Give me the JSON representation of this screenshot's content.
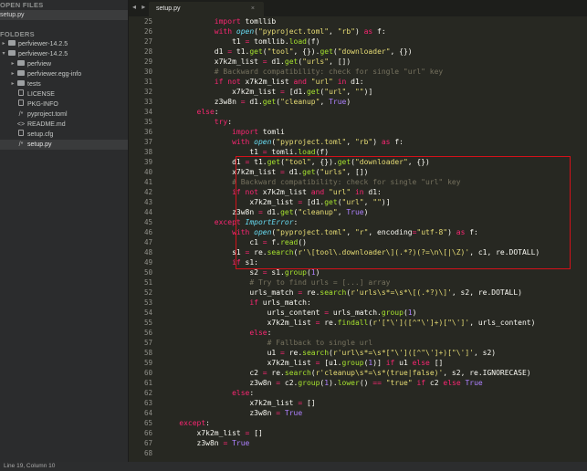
{
  "sidebar": {
    "open_files_title": "OPEN FILES",
    "open_files": [
      "setup.py"
    ],
    "folders_title": "FOLDERS",
    "tree": [
      {
        "label": "perfviewer-14.2.5",
        "depth": 0,
        "kind": "folder",
        "arrow": "▸"
      },
      {
        "label": "perfviewer-14.2.5",
        "depth": 0,
        "kind": "folder-open",
        "arrow": "▾"
      },
      {
        "label": "perfview",
        "depth": 1,
        "kind": "folder",
        "arrow": "▸"
      },
      {
        "label": "perfviewer.egg-info",
        "depth": 1,
        "kind": "folder",
        "arrow": "▸"
      },
      {
        "label": "tests",
        "depth": 1,
        "kind": "folder",
        "arrow": "▸"
      },
      {
        "label": "LICENSE",
        "depth": 1,
        "kind": "file",
        "arrow": ""
      },
      {
        "label": "PKG-INFO",
        "depth": 1,
        "kind": "file",
        "arrow": ""
      },
      {
        "label": "pyproject.toml",
        "depth": 1,
        "kind": "code",
        "arrow": ""
      },
      {
        "label": "README.md",
        "depth": 1,
        "kind": "markup",
        "arrow": ""
      },
      {
        "label": "setup.cfg",
        "depth": 1,
        "kind": "file",
        "arrow": ""
      },
      {
        "label": "setup.py",
        "depth": 1,
        "kind": "code",
        "arrow": "",
        "selected": true
      }
    ]
  },
  "tabs": {
    "nav": "◂ ▸",
    "active": "setup.py",
    "close": "×"
  },
  "editor": {
    "first_line": 25,
    "lines": [
      [
        [
          "",
          "            "
        ],
        [
          "kw",
          "import"
        ],
        [
          "",
          " tomllib"
        ]
      ],
      [
        [
          "",
          "            "
        ],
        [
          "kw",
          "with"
        ],
        [
          "",
          " "
        ],
        [
          "fn",
          "open"
        ],
        [
          "",
          "("
        ],
        [
          "st",
          "\"pyproject.toml\""
        ],
        [
          "",
          ", "
        ],
        [
          "st",
          "\"rb\""
        ],
        [
          "",
          ") "
        ],
        [
          "kw",
          "as"
        ],
        [
          "",
          " f:"
        ]
      ],
      [
        [
          "",
          "                t1 "
        ],
        [
          "kw",
          "="
        ],
        [
          "",
          " tomllib."
        ],
        [
          "bi",
          "load"
        ],
        [
          "",
          "(f)"
        ]
      ],
      [
        [
          "",
          "            d1 "
        ],
        [
          "kw",
          "="
        ],
        [
          "",
          " t1."
        ],
        [
          "bi",
          "get"
        ],
        [
          "",
          "("
        ],
        [
          "st",
          "\"tool\""
        ],
        [
          "",
          ", {})."
        ],
        [
          "bi",
          "get"
        ],
        [
          "",
          "("
        ],
        [
          "st",
          "\"downloader\""
        ],
        [
          "",
          ", {})"
        ]
      ],
      [
        [
          "",
          "            x7k2m_list "
        ],
        [
          "kw",
          "="
        ],
        [
          "",
          " d1."
        ],
        [
          "bi",
          "get"
        ],
        [
          "",
          "("
        ],
        [
          "st",
          "\"urls\""
        ],
        [
          "",
          ", [])"
        ]
      ],
      [
        [
          "cm",
          "            # Backward compatibility: check for single \"url\" key"
        ]
      ],
      [
        [
          "",
          "            "
        ],
        [
          "kw",
          "if not"
        ],
        [
          "",
          " x7k2m_list "
        ],
        [
          "kw",
          "and"
        ],
        [
          "",
          " "
        ],
        [
          "st",
          "\"url\""
        ],
        [
          "",
          " "
        ],
        [
          "kw",
          "in"
        ],
        [
          "",
          " d1:"
        ]
      ],
      [
        [
          "",
          "                x7k2m_list "
        ],
        [
          "kw",
          "="
        ],
        [
          "",
          " [d1."
        ],
        [
          "bi",
          "get"
        ],
        [
          "",
          "("
        ],
        [
          "st",
          "\"url\""
        ],
        [
          "",
          ", "
        ],
        [
          "st",
          "\"\""
        ],
        [
          "",
          ")]"
        ]
      ],
      [
        [
          "",
          "            z3w8n "
        ],
        [
          "kw",
          "="
        ],
        [
          "",
          " d1."
        ],
        [
          "bi",
          "get"
        ],
        [
          "",
          "("
        ],
        [
          "st",
          "\"cleanup\""
        ],
        [
          "",
          ", "
        ],
        [
          "cn",
          "True"
        ],
        [
          "",
          ")"
        ]
      ],
      [
        [
          "",
          "        "
        ],
        [
          "kw",
          "else"
        ],
        [
          "",
          ":"
        ]
      ],
      [
        [
          "",
          "            "
        ],
        [
          "kw",
          "try"
        ],
        [
          "",
          ":"
        ]
      ],
      [
        [
          "",
          "                "
        ],
        [
          "kw",
          "import"
        ],
        [
          "",
          " tomli"
        ]
      ],
      [
        [
          "",
          "                "
        ],
        [
          "kw",
          "with"
        ],
        [
          "",
          " "
        ],
        [
          "fn",
          "open"
        ],
        [
          "",
          "("
        ],
        [
          "st",
          "\"pyproject.toml\""
        ],
        [
          "",
          ", "
        ],
        [
          "st",
          "\"rb\""
        ],
        [
          "",
          ") "
        ],
        [
          "kw",
          "as"
        ],
        [
          "",
          " f:"
        ]
      ],
      [
        [
          "",
          "                    t1 "
        ],
        [
          "kw",
          "="
        ],
        [
          "",
          " tomli."
        ],
        [
          "bi",
          "load"
        ],
        [
          "",
          "(f)"
        ]
      ],
      [
        [
          "",
          "                d1 "
        ],
        [
          "kw",
          "="
        ],
        [
          "",
          " t1."
        ],
        [
          "bi",
          "get"
        ],
        [
          "",
          "("
        ],
        [
          "st",
          "\"tool\""
        ],
        [
          "",
          ", {})."
        ],
        [
          "bi",
          "get"
        ],
        [
          "",
          "("
        ],
        [
          "st",
          "\"downloader\""
        ],
        [
          "",
          ", {})"
        ]
      ],
      [
        [
          "",
          "                x7k2m_list "
        ],
        [
          "kw",
          "="
        ],
        [
          "",
          " d1."
        ],
        [
          "bi",
          "get"
        ],
        [
          "",
          "("
        ],
        [
          "st",
          "\"urls\""
        ],
        [
          "",
          ", [])"
        ]
      ],
      [
        [
          "cm",
          "                # Backward compatibility: check for single \"url\" key"
        ]
      ],
      [
        [
          "",
          "                "
        ],
        [
          "kw",
          "if not"
        ],
        [
          "",
          " x7k2m_list "
        ],
        [
          "kw",
          "and"
        ],
        [
          "",
          " "
        ],
        [
          "st",
          "\"url\""
        ],
        [
          "",
          " "
        ],
        [
          "kw",
          "in"
        ],
        [
          "",
          " d1:"
        ]
      ],
      [
        [
          "",
          "                    x7k2m_list "
        ],
        [
          "kw",
          "="
        ],
        [
          "",
          " [d1."
        ],
        [
          "bi",
          "get"
        ],
        [
          "",
          "("
        ],
        [
          "st",
          "\"url\""
        ],
        [
          "",
          ", "
        ],
        [
          "st",
          "\"\""
        ],
        [
          "",
          ")]"
        ]
      ],
      [
        [
          "",
          "                z3w8n "
        ],
        [
          "kw",
          "="
        ],
        [
          "",
          " d1."
        ],
        [
          "bi",
          "get"
        ],
        [
          "",
          "("
        ],
        [
          "st",
          "\"cleanup\""
        ],
        [
          "",
          ", "
        ],
        [
          "cn",
          "True"
        ],
        [
          "",
          ")"
        ]
      ],
      [
        [
          "",
          "            "
        ],
        [
          "kw",
          "except"
        ],
        [
          "",
          " "
        ],
        [
          "ex",
          "ImportError"
        ],
        [
          "",
          ":"
        ]
      ],
      [
        [
          "",
          "                "
        ],
        [
          "kw",
          "with"
        ],
        [
          "",
          " "
        ],
        [
          "fn",
          "open"
        ],
        [
          "",
          "("
        ],
        [
          "st",
          "\"pyproject.toml\""
        ],
        [
          "",
          ", "
        ],
        [
          "st",
          "\"r\""
        ],
        [
          "",
          ", encoding"
        ],
        [
          "kw",
          "="
        ],
        [
          "st",
          "\"utf-8\""
        ],
        [
          "",
          ") "
        ],
        [
          "kw",
          "as"
        ],
        [
          "",
          " f:"
        ]
      ],
      [
        [
          "",
          "                    c1 "
        ],
        [
          "kw",
          "="
        ],
        [
          "",
          " f."
        ],
        [
          "bi",
          "read"
        ],
        [
          "",
          "()"
        ]
      ],
      [
        [
          "",
          "                s1 "
        ],
        [
          "kw",
          "="
        ],
        [
          "",
          " re."
        ],
        [
          "bi",
          "search"
        ],
        [
          "",
          "("
        ],
        [
          "st",
          "r'\\[tool\\.downloader\\](.*?)(?=\\n\\[|\\Z)'"
        ],
        [
          "",
          ", c1, re.DOTALL)"
        ]
      ],
      [
        [
          "",
          "                "
        ],
        [
          "kw",
          "if"
        ],
        [
          "",
          " s1:"
        ]
      ],
      [
        [
          "",
          "                    s2 "
        ],
        [
          "kw",
          "="
        ],
        [
          "",
          " s1."
        ],
        [
          "bi",
          "group"
        ],
        [
          "",
          "("
        ],
        [
          "cn",
          "1"
        ],
        [
          "",
          ")"
        ]
      ],
      [
        [
          "cm",
          "                    # Try to find urls = [...] array"
        ]
      ],
      [
        [
          "",
          "                    urls_match "
        ],
        [
          "kw",
          "="
        ],
        [
          "",
          " re."
        ],
        [
          "bi",
          "search"
        ],
        [
          "",
          "("
        ],
        [
          "st",
          "r'urls\\s*=\\s*\\[(.*?)\\]'"
        ],
        [
          "",
          ", s2, re.DOTALL)"
        ]
      ],
      [
        [
          "",
          "                    "
        ],
        [
          "kw",
          "if"
        ],
        [
          "",
          " urls_match:"
        ]
      ],
      [
        [
          "",
          "                        urls_content "
        ],
        [
          "kw",
          "="
        ],
        [
          "",
          " urls_match."
        ],
        [
          "bi",
          "group"
        ],
        [
          "",
          "("
        ],
        [
          "cn",
          "1"
        ],
        [
          "",
          ")"
        ]
      ],
      [
        [
          "",
          "                        x7k2m_list "
        ],
        [
          "kw",
          "="
        ],
        [
          "",
          " re."
        ],
        [
          "bi",
          "findall"
        ],
        [
          "",
          "("
        ],
        [
          "st",
          "r'[\"\\']([^\"\\']+)[\"\\']'"
        ],
        [
          "",
          ", urls_content)"
        ]
      ],
      [
        [
          "",
          "                    "
        ],
        [
          "kw",
          "else"
        ],
        [
          "",
          ":"
        ]
      ],
      [
        [
          "cm",
          "                        # Fallback to single url"
        ]
      ],
      [
        [
          "",
          "                        u1 "
        ],
        [
          "kw",
          "="
        ],
        [
          "",
          " re."
        ],
        [
          "bi",
          "search"
        ],
        [
          "",
          "("
        ],
        [
          "st",
          "r'url\\s*=\\s*[\"\\']([^\"\\']+)[\"\\']'"
        ],
        [
          "",
          ", s2)"
        ]
      ],
      [
        [
          "",
          "                        x7k2m_list "
        ],
        [
          "kw",
          "="
        ],
        [
          "",
          " [u1."
        ],
        [
          "bi",
          "group"
        ],
        [
          "",
          "("
        ],
        [
          "cn",
          "1"
        ],
        [
          "",
          ")] "
        ],
        [
          "kw",
          "if"
        ],
        [
          "",
          " u1 "
        ],
        [
          "kw",
          "else"
        ],
        [
          "",
          " []"
        ]
      ],
      [
        [
          "",
          "                    c2 "
        ],
        [
          "kw",
          "="
        ],
        [
          "",
          " re."
        ],
        [
          "bi",
          "search"
        ],
        [
          "",
          "("
        ],
        [
          "st",
          "r'cleanup\\s*=\\s*(true|false)'"
        ],
        [
          "",
          ", s2, re.IGNORECASE)"
        ]
      ],
      [
        [
          "",
          "                    z3w8n "
        ],
        [
          "kw",
          "="
        ],
        [
          "",
          " c2."
        ],
        [
          "bi",
          "group"
        ],
        [
          "",
          "("
        ],
        [
          "cn",
          "1"
        ],
        [
          "",
          ")."
        ],
        [
          "bi",
          "lower"
        ],
        [
          "",
          "() "
        ],
        [
          "kw",
          "=="
        ],
        [
          "",
          " "
        ],
        [
          "st",
          "\"true\""
        ],
        [
          "",
          " "
        ],
        [
          "kw",
          "if"
        ],
        [
          "",
          " c2 "
        ],
        [
          "kw",
          "else"
        ],
        [
          "",
          " "
        ],
        [
          "cn",
          "True"
        ]
      ],
      [
        [
          "",
          "                "
        ],
        [
          "kw",
          "else"
        ],
        [
          "",
          ":"
        ]
      ],
      [
        [
          "",
          "                    x7k2m_list "
        ],
        [
          "kw",
          "="
        ],
        [
          "",
          " []"
        ]
      ],
      [
        [
          "",
          "                    z3w8n "
        ],
        [
          "kw",
          "="
        ],
        [
          "",
          " "
        ],
        [
          "cn",
          "True"
        ]
      ],
      [
        [
          "",
          "    "
        ],
        [
          "kw",
          "except"
        ],
        [
          "",
          ":"
        ]
      ],
      [
        [
          "",
          "        x7k2m_list "
        ],
        [
          "kw",
          "="
        ],
        [
          "",
          " []"
        ]
      ],
      [
        [
          "",
          "        z3w8n "
        ],
        [
          "kw",
          "="
        ],
        [
          "",
          " "
        ],
        [
          "cn",
          "True"
        ]
      ],
      [
        [
          "",
          ""
        ]
      ]
    ]
  },
  "status": {
    "position": "Line 19, Column 10"
  },
  "colors": {
    "highlight_border": "#d4111a",
    "editor_bg": "#272822"
  }
}
